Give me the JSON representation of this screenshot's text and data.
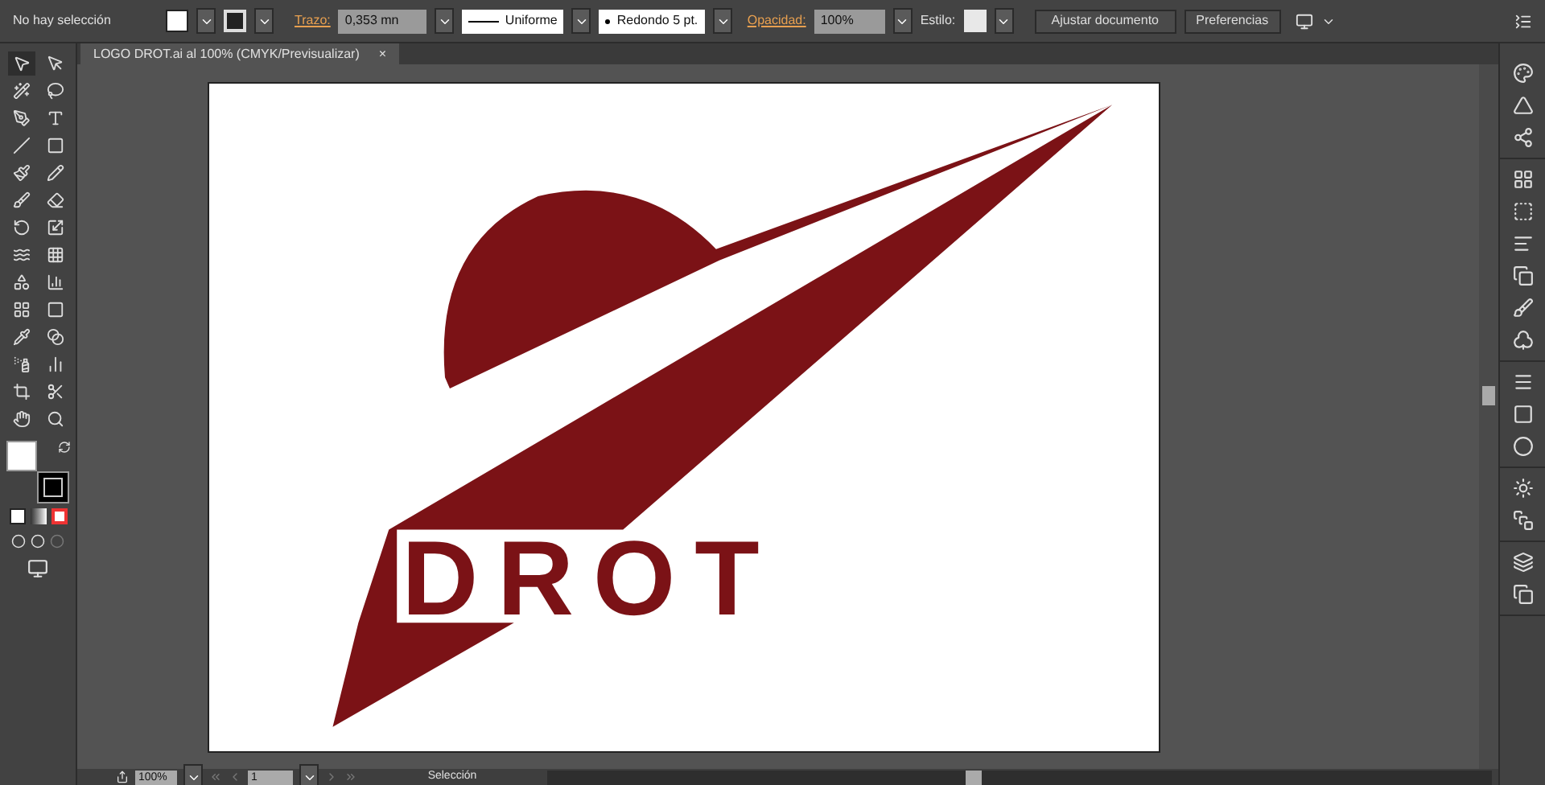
{
  "control_bar": {
    "selection": "No hay selección",
    "stroke_label": "Trazo:",
    "stroke_weight": "0,353 mn",
    "profile": "Uniforme",
    "brush": "Redondo 5 pt.",
    "opacity_label": "Opacidad:",
    "opacity": "100%",
    "style_label": "Estilo:",
    "buttons": [
      "Ajustar documento",
      "Preferencias"
    ]
  },
  "document_tab": {
    "title": "LOGO DROT.ai al 100% (CMYK/Previsualizar)",
    "close": "×"
  },
  "artwork": {
    "logo_text": "DROT"
  },
  "status_bar": {
    "zoom": "100%",
    "artboard": "1",
    "tool": "Selección"
  }
}
